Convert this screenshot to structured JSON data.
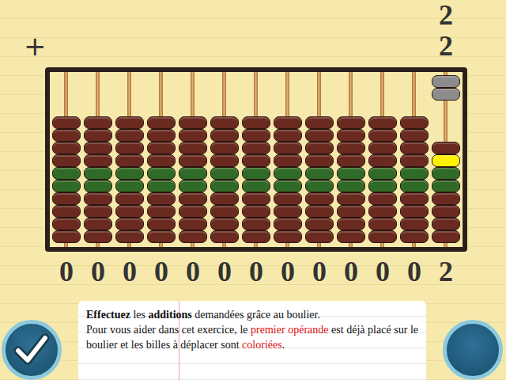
{
  "operation": {
    "operator": "+",
    "operands": [
      "2",
      "2"
    ]
  },
  "abacus": {
    "columns": [
      {
        "digit": "0",
        "beads_up": 0,
        "highlighted": []
      },
      {
        "digit": "0",
        "beads_up": 0,
        "highlighted": []
      },
      {
        "digit": "0",
        "beads_up": 0,
        "highlighted": []
      },
      {
        "digit": "0",
        "beads_up": 0,
        "highlighted": []
      },
      {
        "digit": "0",
        "beads_up": 0,
        "highlighted": []
      },
      {
        "digit": "0",
        "beads_up": 0,
        "highlighted": []
      },
      {
        "digit": "0",
        "beads_up": 0,
        "highlighted": []
      },
      {
        "digit": "0",
        "beads_up": 0,
        "highlighted": []
      },
      {
        "digit": "0",
        "beads_up": 0,
        "highlighted": []
      },
      {
        "digit": "0",
        "beads_up": 0,
        "highlighted": []
      },
      {
        "digit": "0",
        "beads_up": 0,
        "highlighted": []
      },
      {
        "digit": "0",
        "beads_up": 0,
        "highlighted": []
      },
      {
        "digit": "2",
        "beads_up": 2,
        "highlighted": [
          1
        ]
      }
    ]
  },
  "instructions": {
    "paragraphs": [
      [
        {
          "text": "Effectuez",
          "kind": "bold"
        },
        {
          "text": " les ",
          "kind": "plain"
        },
        {
          "text": "additions",
          "kind": "bold"
        },
        {
          "text": " demandées grâce au boulier.",
          "kind": "plain"
        }
      ],
      [
        {
          "text": "Pour vous aider dans cet exercice, le ",
          "kind": "plain"
        },
        {
          "text": "premier opérande",
          "kind": "red"
        },
        {
          "text": " est déjà placé sur le boulier et les billes à déplacer sont ",
          "kind": "plain"
        },
        {
          "text": "coloriées",
          "kind": "red"
        },
        {
          "text": ".",
          "kind": "plain"
        }
      ]
    ]
  }
}
